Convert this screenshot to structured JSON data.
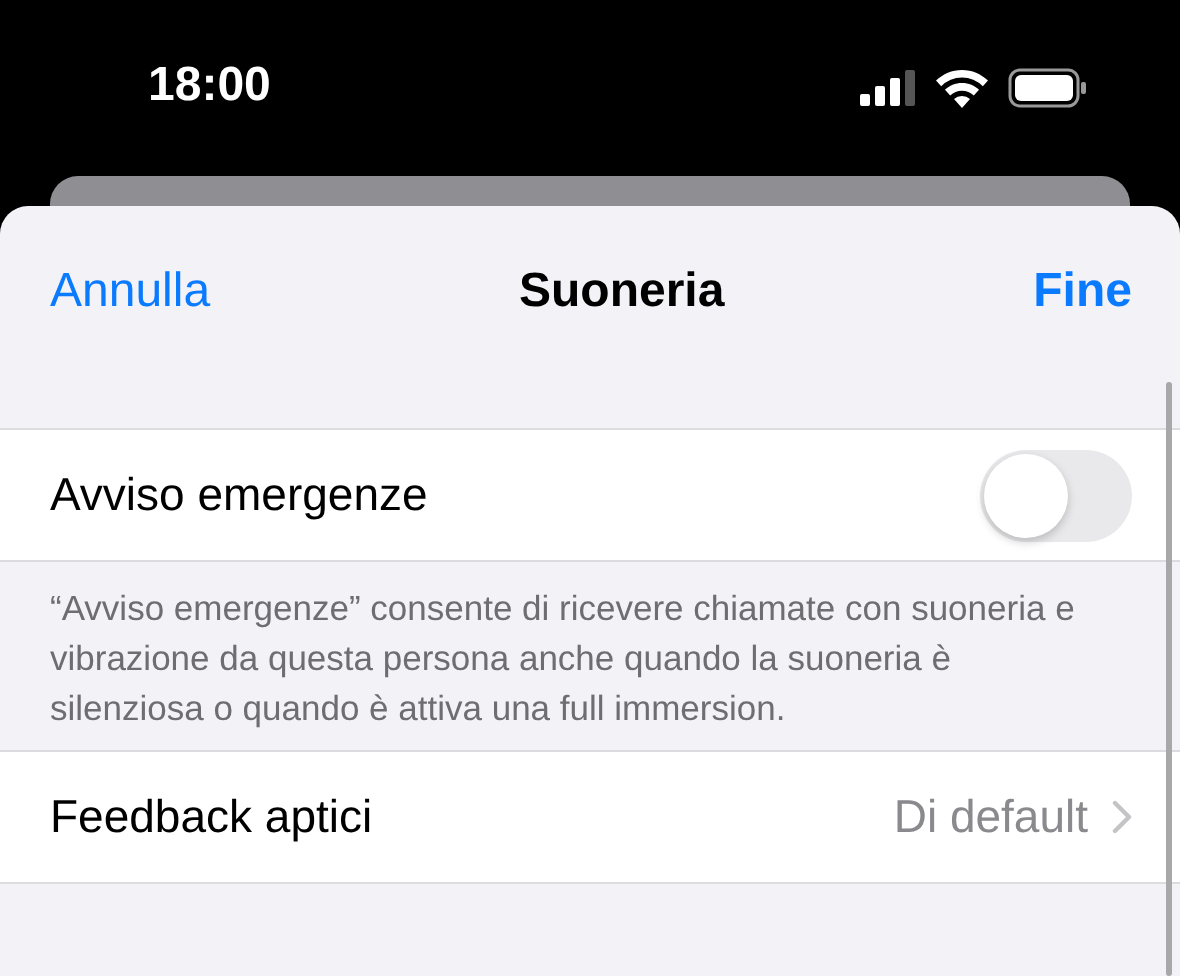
{
  "status_bar": {
    "time": "18:00"
  },
  "nav": {
    "cancel": "Annulla",
    "title": "Suoneria",
    "done": "Fine"
  },
  "rows": [
    {
      "kind": "toggle",
      "label": "Avviso emergenze",
      "on": false,
      "footer": "“Avviso emergenze” consente di ricevere chiamate con suoneria e vibrazione da questa persona anche quando la suoneria è silenziosa o quando è attiva una full immersion."
    },
    {
      "kind": "disclosure",
      "label": "Feedback aptici",
      "value": "Di default"
    }
  ]
}
